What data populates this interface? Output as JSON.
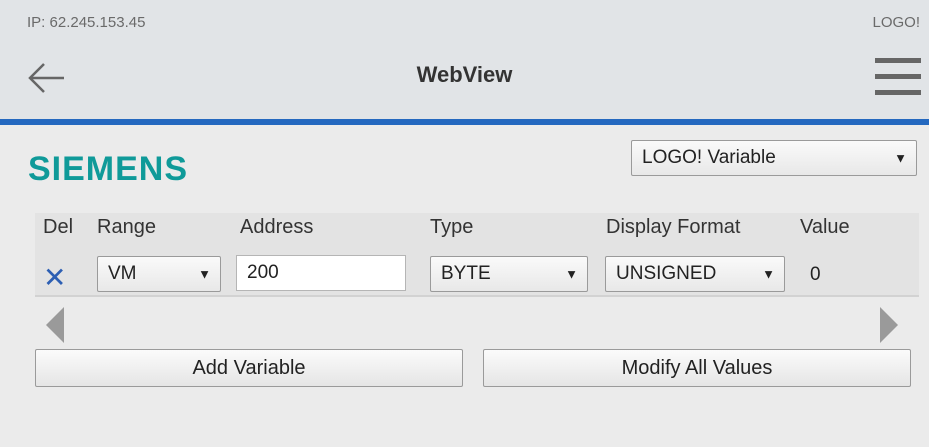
{
  "header": {
    "ip_text": "IP: 62.245.153.45",
    "device_tag": "LOGO!",
    "title": "WebView"
  },
  "brand": {
    "name": "SIEMENS",
    "color": "#0f9a99"
  },
  "view_select": {
    "value": "LOGO! Variable"
  },
  "table": {
    "columns": [
      "Del",
      "Range",
      "Address",
      "Type",
      "Display Format",
      "Value"
    ],
    "rows": [
      {
        "range": "VM",
        "address": "200",
        "type": "BYTE",
        "format": "UNSIGNED",
        "value": "0"
      }
    ]
  },
  "buttons": {
    "add": "Add Variable",
    "modify": "Modify All Values"
  },
  "icons": [
    "back-arrow-icon",
    "hamburger-menu-icon",
    "delete-x-icon",
    "scroll-left-icon",
    "scroll-right-icon",
    "dropdown-arrow-icon"
  ],
  "colors": {
    "accent_line": "#2468bf",
    "delete_icon": "#2d5fb3"
  }
}
